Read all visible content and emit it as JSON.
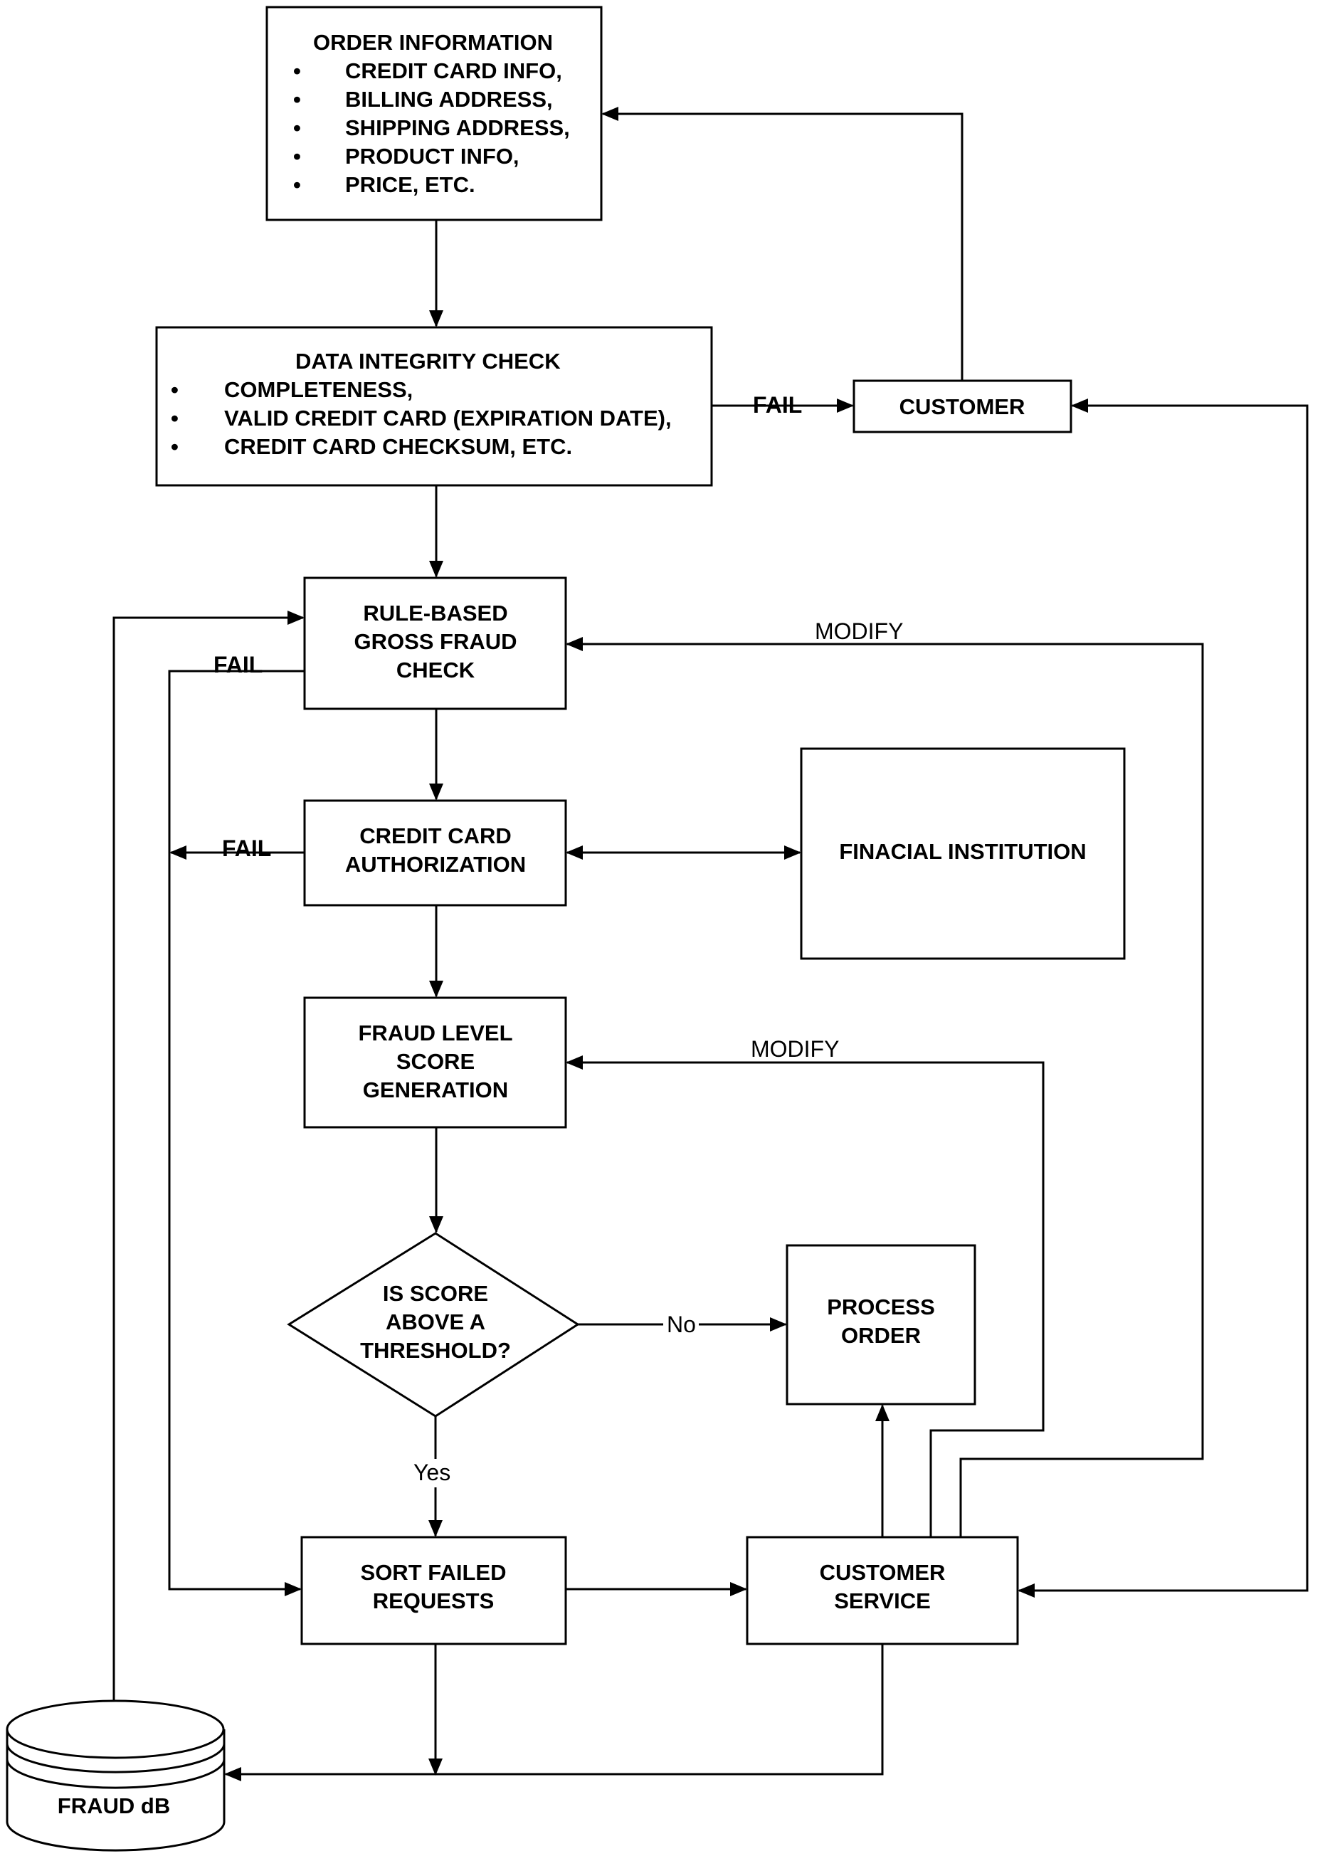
{
  "diagram": {
    "nodes": {
      "order_info": {
        "title": "ORDER INFORMATION",
        "bullets": [
          "CREDIT CARD INFO,",
          "BILLING ADDRESS,",
          "SHIPPING ADDRESS,",
          "PRODUCT INFO,",
          "PRICE, ETC."
        ]
      },
      "data_integrity": {
        "title": "DATA INTEGRITY CHECK",
        "bullets": [
          "COMPLETENESS,",
          "VALID CREDIT CARD (EXPIRATION DATE),",
          "CREDIT CARD CHECKSUM, ETC."
        ]
      },
      "customer": {
        "lines": [
          "CUSTOMER"
        ]
      },
      "rule_based": {
        "lines": [
          "RULE-BASED",
          "GROSS FRAUD",
          "CHECK"
        ]
      },
      "cc_auth": {
        "lines": [
          "CREDIT CARD",
          "AUTHORIZATION"
        ]
      },
      "financial": {
        "lines": [
          "FINACIAL INSTITUTION"
        ]
      },
      "fraud_score": {
        "lines": [
          "FRAUD LEVEL",
          "SCORE",
          "GENERATION"
        ]
      },
      "threshold": {
        "lines": [
          "IS SCORE",
          "ABOVE A",
          "THRESHOLD?"
        ]
      },
      "process_order": {
        "lines": [
          "PROCESS",
          "ORDER"
        ]
      },
      "sort_failed": {
        "lines": [
          "SORT FAILED",
          "REQUESTS"
        ]
      },
      "customer_service": {
        "lines": [
          "CUSTOMER",
          "SERVICE"
        ]
      },
      "fraud_db": {
        "lines": [
          "FRAUD dB"
        ]
      }
    },
    "edge_labels": {
      "fail_integrity": "FAIL",
      "fail_rule": "FAIL",
      "fail_auth": "FAIL",
      "modify_rule": "MODIFY",
      "modify_score": "MODIFY",
      "no": "No",
      "yes": "Yes"
    },
    "bullet": "•"
  }
}
